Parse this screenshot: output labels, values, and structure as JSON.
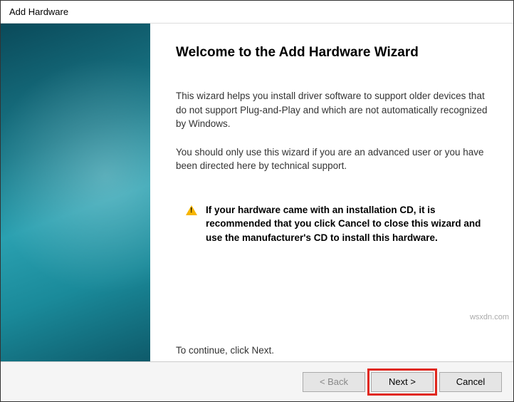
{
  "window": {
    "title": "Add Hardware"
  },
  "heading": "Welcome to the Add Hardware Wizard",
  "body": {
    "p1": "This wizard helps you install driver software to support older devices that do not support Plug-and-Play and which are not automatically recognized by Windows.",
    "p2": "You should only use this wizard if you are an advanced user or you have been directed here by technical support.",
    "warning": "If your hardware came with an installation CD, it is recommended that you click Cancel to close this wizard and use the manufacturer's CD to install this hardware.",
    "continue": "To continue, click Next."
  },
  "buttons": {
    "back": "< Back",
    "next": "Next >",
    "cancel": "Cancel"
  },
  "watermark": "wsxdn.com"
}
